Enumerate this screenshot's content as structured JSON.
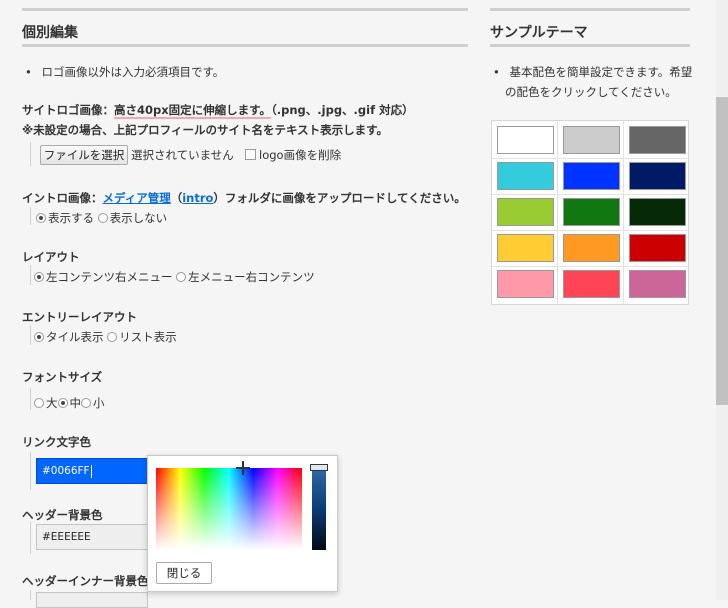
{
  "left": {
    "title": "個別編集",
    "note": "ロゴ画像以外は入力必須項目です。",
    "logo": {
      "label": "サイトロゴ画像：",
      "highlight": "高さ40px固定に伸縮します。",
      "formats": "（.png、.jpg、.gif 対応）",
      "note": "※未設定の場合、上記プロフィールのサイト名をテキスト表示します。",
      "file_button": "ファイルを選択",
      "file_status": "選択されていません",
      "delete_label": "logo画像を削除"
    },
    "intro": {
      "label": "イントロ画像：",
      "link": "メディア管理",
      "paren_open": "（",
      "folder": "intro",
      "rest": "）フォルダに画像をアップロードしてください。",
      "options": [
        "表示する",
        "表示しない"
      ],
      "selected": 0
    },
    "layout": {
      "label": "レイアウト",
      "options": [
        "左コンテンツ右メニュー",
        "左メニュー右コンテンツ"
      ],
      "selected": 0
    },
    "entry_layout": {
      "label": "エントリーレイアウト",
      "options": [
        "タイル表示",
        "リスト表示"
      ],
      "selected": 0
    },
    "font_size": {
      "label": "フォントサイズ",
      "options": [
        "大",
        "中",
        "小"
      ],
      "selected": 1
    },
    "link_color": {
      "label": "リンク文字色",
      "value": "#0066FF"
    },
    "header_bg": {
      "label": "ヘッダー背景色",
      "value": "#EEEEEE"
    },
    "header_inner_bg": {
      "label": "ヘッダーインナー背景色"
    }
  },
  "picker": {
    "close_label": "閉じる"
  },
  "right": {
    "title": "サンプルテーマ",
    "note_line1": "基本配色を簡単設定できます。希望",
    "note_line2": "の配色をクリックしてください。",
    "swatches": [
      [
        "#ffffff",
        "#cccccc",
        "#666666"
      ],
      [
        "#33ccdd",
        "#0033ff",
        "#001a66"
      ],
      [
        "#99cc33",
        "#117711",
        "#052a05"
      ],
      [
        "#ffcc33",
        "#ff9922",
        "#cc0000"
      ],
      [
        "#ff99aa",
        "#ff4455",
        "#cc6699"
      ]
    ]
  },
  "colors": {
    "accent": "#0066FF",
    "link": "#0b6cd6",
    "highlight_underline": "#f3a6b6"
  }
}
